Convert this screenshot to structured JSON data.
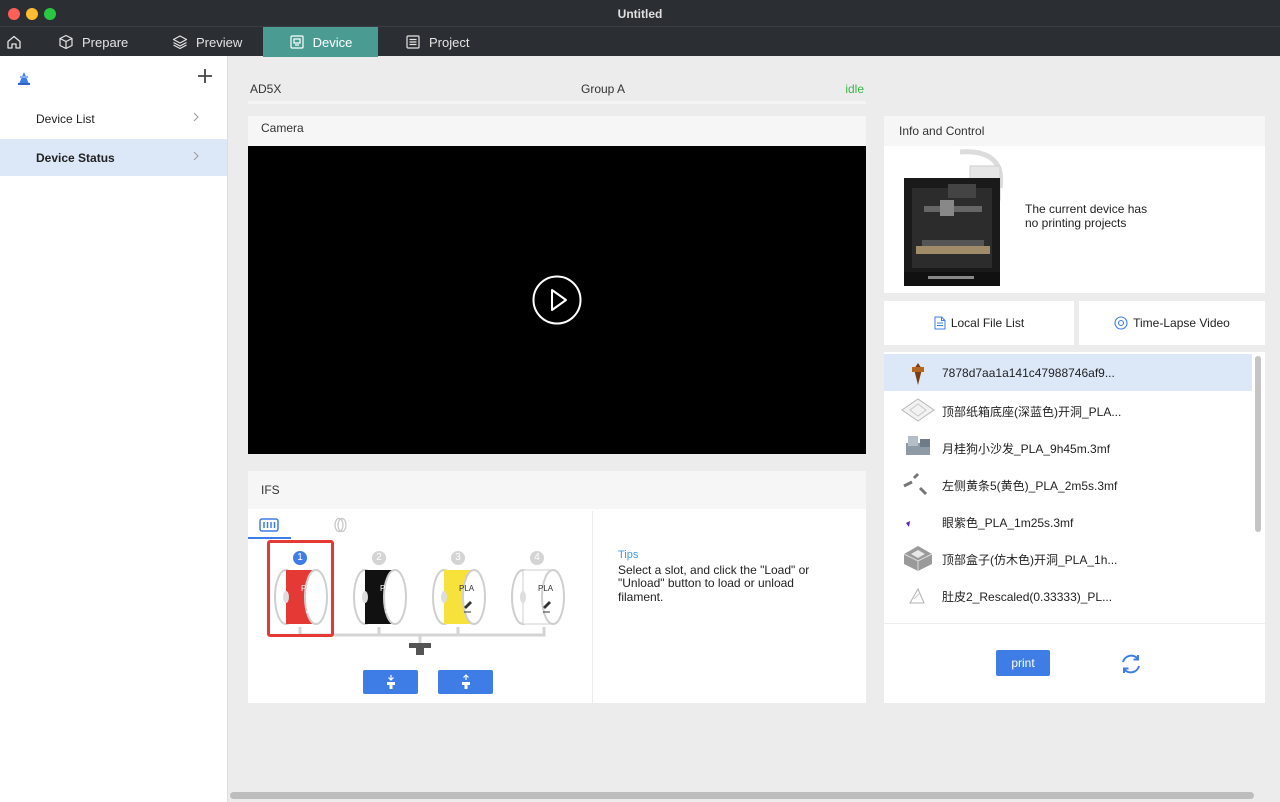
{
  "window": {
    "title": "Untitled"
  },
  "tabs": [
    {
      "label": "Prepare"
    },
    {
      "label": "Preview"
    },
    {
      "label": "Device",
      "active": true
    },
    {
      "label": "Project"
    }
  ],
  "sidebar": {
    "items": [
      {
        "label": "Device List"
      },
      {
        "label": "Device Status",
        "selected": true
      }
    ]
  },
  "device": {
    "name": "AD5X",
    "group": "Group A",
    "status": "idle",
    "status_color": "#3ab54a"
  },
  "camera": {
    "title": "Camera"
  },
  "ifs": {
    "title": "IFS",
    "slots": [
      {
        "number": "1",
        "material": "PLA",
        "color": "#e53935",
        "selected": true
      },
      {
        "number": "2",
        "material": "PLA",
        "color": "#111111"
      },
      {
        "number": "3",
        "material": "PLA",
        "color": "#f7e13b"
      },
      {
        "number": "4",
        "material": "PLA",
        "color": "#ffffff"
      }
    ],
    "tips_title": "Tips",
    "tips_text": "Select a slot, and click the \"Load\" or \"Unload\" button to load or unload filament."
  },
  "info": {
    "title": "Info and Control",
    "message_line1": "The current device has",
    "message_line2": "no printing projects"
  },
  "file_tabs": {
    "local": "Local File List",
    "timelapse": "Time-Lapse Video"
  },
  "files": [
    {
      "name": "7878d7aa1a141c47988746af9...",
      "selected": true
    },
    {
      "name": "顶部纸箱底座(深蓝色)开洞_PLA..."
    },
    {
      "name": "月桂狗小沙发_PLA_9h45m.3mf"
    },
    {
      "name": "左侧黄条5(黄色)_PLA_2m5s.3mf"
    },
    {
      "name": "眼紫色_PLA_1m25s.3mf"
    },
    {
      "name": "顶部盒子(仿木色)开洞_PLA_1h..."
    },
    {
      "name": "肚皮2_Rescaled(0.33333)_PL..."
    }
  ],
  "actions": {
    "print_label": "print"
  },
  "colors": {
    "accent": "#3d7de5",
    "tab_active": "#4a9c93",
    "selection": "#dce8f8"
  }
}
